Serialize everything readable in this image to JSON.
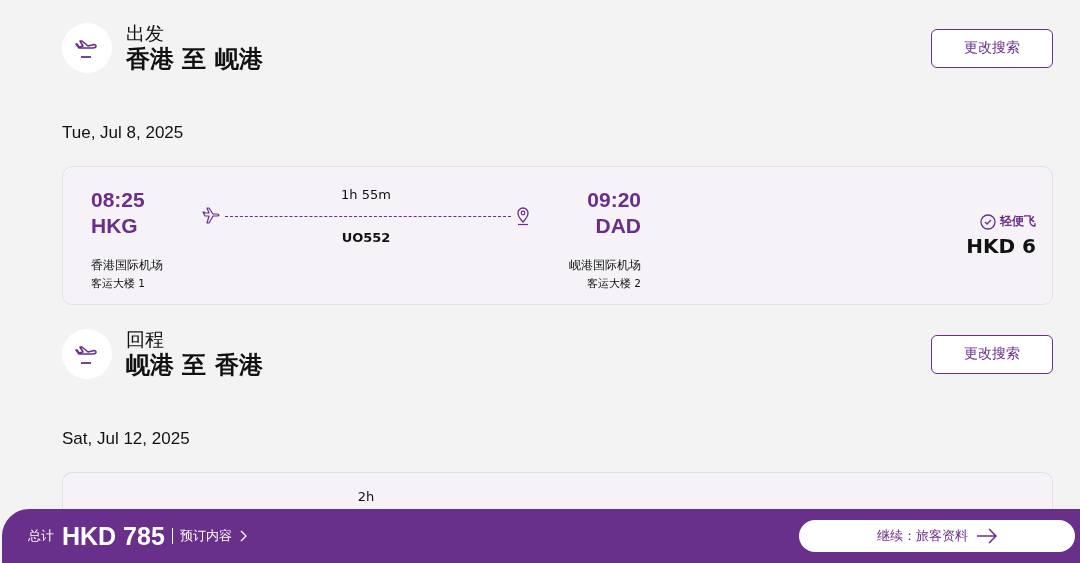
{
  "segments": [
    {
      "label": "出发",
      "route": "香港 至 岘港",
      "button": "更改搜索",
      "date": "Tue, Jul 8, 2025",
      "flight": {
        "depart_time": "08:25",
        "depart_code": "HKG",
        "depart_airport": "香港国际机场",
        "depart_terminal": "客运大楼 1",
        "duration": "1h 55m",
        "flight_no": "UO552",
        "arrive_time": "09:20",
        "arrive_code": "DAD",
        "arrive_airport": "岘港国际机场",
        "arrive_terminal": "客运大楼 2",
        "fare_name": "轻便飞",
        "price": "HKD 6"
      }
    },
    {
      "label": "回程",
      "route": "岘港 至 香港",
      "button": "更改搜索",
      "date": "Sat, Jul 12, 2025",
      "flight": {
        "duration": "2h"
      }
    }
  ],
  "footer": {
    "total_label": "总计",
    "total": "HKD 785",
    "details_link": "预订内容",
    "continue_button": "继续：旅客资料"
  }
}
